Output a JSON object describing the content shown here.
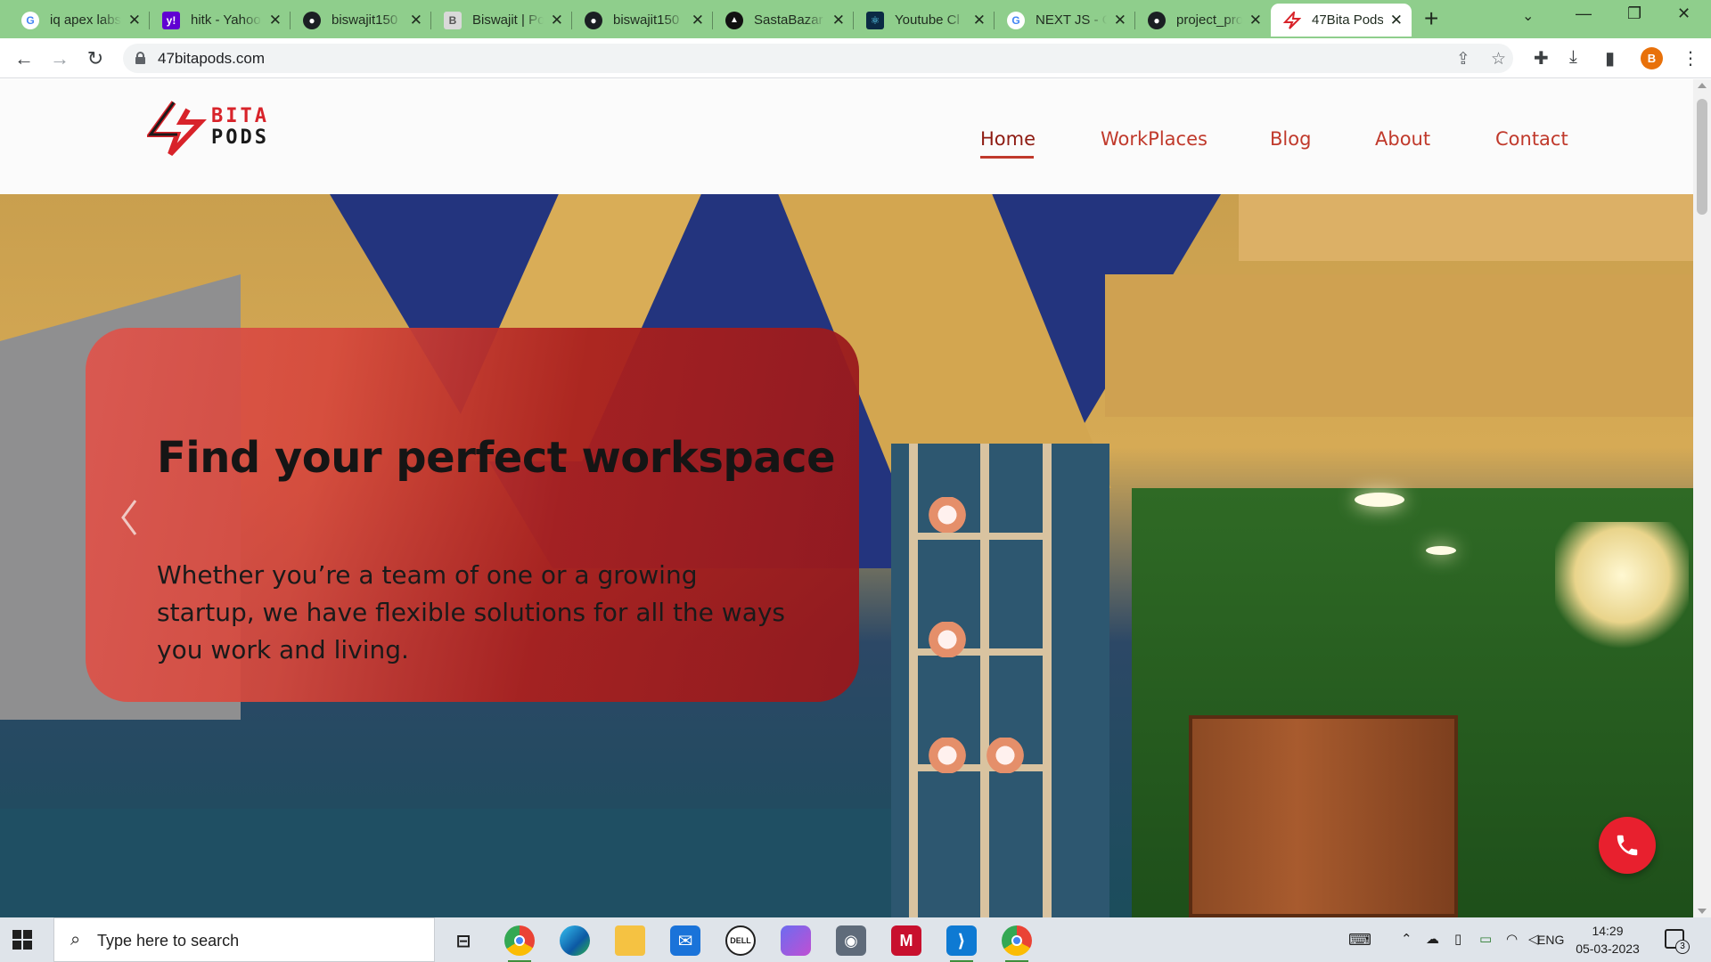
{
  "browser": {
    "tabs": [
      {
        "title": "iq apex labs",
        "icon": "google-icon",
        "color": "#4285f4"
      },
      {
        "title": "hitk - Yahoo",
        "icon": "yahoo-icon",
        "color": "#6001d2"
      },
      {
        "title": "biswajit150",
        "icon": "github-icon",
        "color": "#1b1f23"
      },
      {
        "title": "Biswajit | Po",
        "icon": "portfolio-icon",
        "color": "#8a8a8a"
      },
      {
        "title": "biswajit150",
        "icon": "github-icon",
        "color": "#1b1f23"
      },
      {
        "title": "SastaBazar",
        "icon": "sastabazar-icon",
        "color": "#111111"
      },
      {
        "title": "Youtube Cl",
        "icon": "react-icon",
        "color": "#0b2a44"
      },
      {
        "title": "NEXT JS - G",
        "icon": "google-icon",
        "color": "#4285f4"
      },
      {
        "title": "project_pro",
        "icon": "github-icon",
        "color": "#1b1f23"
      },
      {
        "title": "47Bita Pods",
        "icon": "bitapods-icon",
        "color": "#d8232a",
        "active": true
      }
    ],
    "url": "47bitapods.com",
    "profile_initial": "B"
  },
  "site": {
    "logo": {
      "line1": "BITA",
      "line2": "PODS"
    },
    "nav": [
      {
        "label": "Home",
        "active": true
      },
      {
        "label": "WorkPlaces"
      },
      {
        "label": "Blog"
      },
      {
        "label": "About"
      },
      {
        "label": "Contact"
      }
    ],
    "hero": {
      "title": "Find your perfect workspace",
      "body": "Whether you’re a team of one or a growing startup, we have flexible solutions for all the ways you work and living."
    },
    "accent_color": "#c0392b",
    "call_button_color": "#e8202e"
  },
  "taskbar": {
    "search_placeholder": "Type here to search",
    "apps": [
      "task-view-icon",
      "chrome-icon",
      "edge-icon",
      "file-explorer-icon",
      "mail-icon",
      "dell-icon",
      "copilot-icon",
      "camera-icon",
      "mcafee-icon",
      "vscode-icon",
      "chrome-profile-icon"
    ],
    "language": "ENG",
    "time": "14:29",
    "date": "05-03-2023",
    "notification_count": "3"
  }
}
